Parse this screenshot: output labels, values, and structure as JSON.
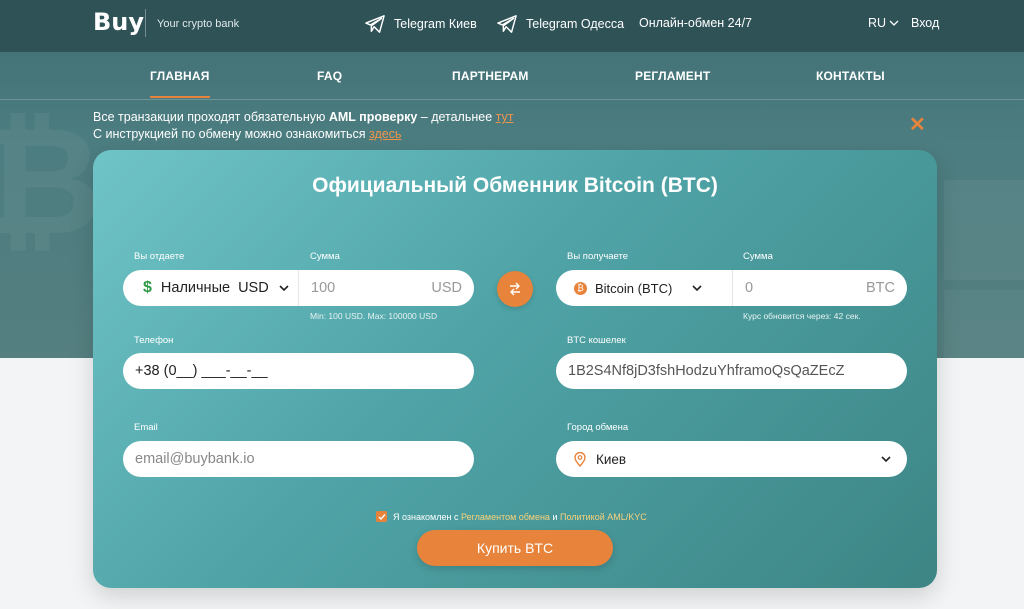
{
  "header": {
    "logo": "Buy",
    "tagline": "Your crypto bank",
    "links": {
      "telegram_kiev": "Telegram Киев",
      "telegram_odessa": "Telegram Одесса",
      "online": "Онлайн-обмен 24/7"
    },
    "language": "RU",
    "login": "Вход"
  },
  "nav": {
    "items": [
      "ГЛАВНАЯ",
      "FAQ",
      "ПАРТНЕРАМ",
      "РЕГЛАМЕНТ",
      "КОНТАКТЫ"
    ],
    "active": "ГЛАВНАЯ"
  },
  "notice": {
    "line1_pre": "Все транзакции проходят обязательную ",
    "line1_bold": "AML проверку",
    "line1_mid": " – детальнее ",
    "line1_link": "тут",
    "line2_pre": "С инструкцией по обмену можно ознакомиться ",
    "line2_link": "здесь"
  },
  "form": {
    "title": "Официальный Обменник Bitcoin (BTC)",
    "give": {
      "label": "Вы отдаете",
      "currency_symbol": "$",
      "method": "Наличные",
      "currency": "USD",
      "amount_label": "Сумма",
      "amount_placeholder": "100",
      "amount_unit": "USD",
      "limits": "Min: 100 USD. Max: 100000 USD"
    },
    "receive": {
      "label": "Вы получаете",
      "currency_symbol": "₿",
      "currency": "Bitcoin (BTC)",
      "amount_label": "Сумма",
      "amount_placeholder": "0",
      "amount_unit": "BTC",
      "rate_note": "Курс обновится через: 42 сек."
    },
    "phone": {
      "label": "Телефон",
      "value": "+38 (0__) ___-__-__"
    },
    "wallet": {
      "label": "BTC кошелек",
      "value": "1B2S4Nf8jD3fshHodzuYhframoQsQaZEcZ"
    },
    "email": {
      "label": "Email",
      "placeholder": "email@buybank.io"
    },
    "city": {
      "label": "Город обмена",
      "value": "Киев"
    },
    "agreement": {
      "pre": "Я ознакомлен с ",
      "link1": "Регламентом обмена",
      "mid": " и ",
      "link2": "Политикой AML/KYC",
      "checked": true
    },
    "submit": "Купить BTC"
  },
  "colors": {
    "accent": "#e7833a",
    "header_bg": "#2f5257",
    "card_from": "#6fc4c8",
    "card_to": "#3d8585"
  }
}
